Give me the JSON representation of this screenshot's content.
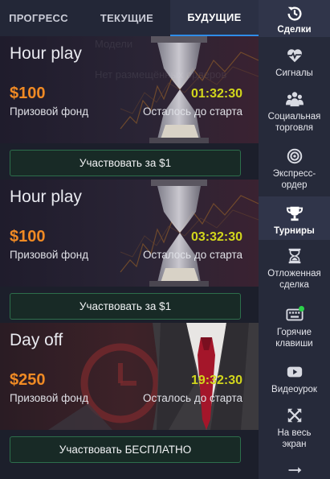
{
  "tabs": [
    {
      "label": "ПРОГРЕСС"
    },
    {
      "label": "ТЕКУЩИЕ"
    },
    {
      "label": "БУДУЩИЕ"
    }
  ],
  "background_text": {
    "line1": "Модели",
    "line2": "Нет размещённых ордеров"
  },
  "tournaments": [
    {
      "title": "Hour play",
      "prize": "$100",
      "prize_label": "Призовой фонд",
      "timer": "01:32:30",
      "timer_label": "Осталось до старта",
      "button": "Участвовать за $1"
    },
    {
      "title": "Hour play",
      "prize": "$100",
      "prize_label": "Призовой фонд",
      "timer": "03:32:30",
      "timer_label": "Осталось до старта",
      "button": "Участвовать за $1"
    },
    {
      "title": "Day off",
      "prize": "$250",
      "prize_label": "Призовой фонд",
      "timer": "19:32:30",
      "timer_label": "Осталось до старта",
      "button": "Участвовать БЕСПЛАТНО"
    }
  ],
  "sidebar": {
    "items": [
      {
        "label": "Сделки",
        "icon": "history-icon",
        "active": true
      },
      {
        "label": "Сигналы",
        "icon": "heartbeat-icon"
      },
      {
        "label": "Социальная торговля",
        "icon": "users-icon"
      },
      {
        "label": "Экспресс-ордер",
        "icon": "target-icon"
      },
      {
        "label": "Турниры",
        "icon": "trophy-icon",
        "active": true
      },
      {
        "label": "Отложенная сделка",
        "icon": "hourglass-icon"
      },
      {
        "label": "Горячие клавиши",
        "icon": "keyboard-icon"
      },
      {
        "label": "Видеоурок",
        "icon": "youtube-icon"
      },
      {
        "label": "На весь экран",
        "icon": "expand-icon"
      },
      {
        "label": "",
        "icon": "arrow-right-icon"
      }
    ]
  },
  "colors": {
    "accent_tab": "#2f8ce8",
    "prize": "#f08a24",
    "timer": "#d2d61c",
    "button_border": "#2d6e4b",
    "notification_dot": "#2bd14a"
  }
}
